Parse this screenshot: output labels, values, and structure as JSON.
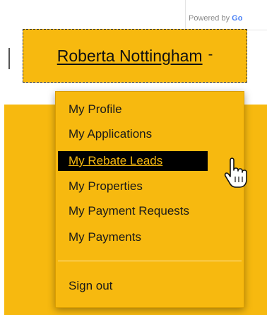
{
  "branding": {
    "powered_prefix": "Powered by",
    "powered_brand": "Go"
  },
  "account": {
    "user_name": "Roberta Nottingham",
    "caret": "-"
  },
  "menu": {
    "items": [
      {
        "label": "My Profile"
      },
      {
        "label": "My Applications"
      },
      {
        "label": "My Rebate Leads",
        "active": true
      },
      {
        "label": "My Properties"
      },
      {
        "label": "My Payment Requests"
      },
      {
        "label": "My Payments"
      }
    ],
    "sign_out": "Sign out"
  },
  "colors": {
    "accent": "#f7b90f",
    "highlight_bg": "#000000"
  },
  "icons": {
    "cursor": "hand-pointer-icon"
  }
}
